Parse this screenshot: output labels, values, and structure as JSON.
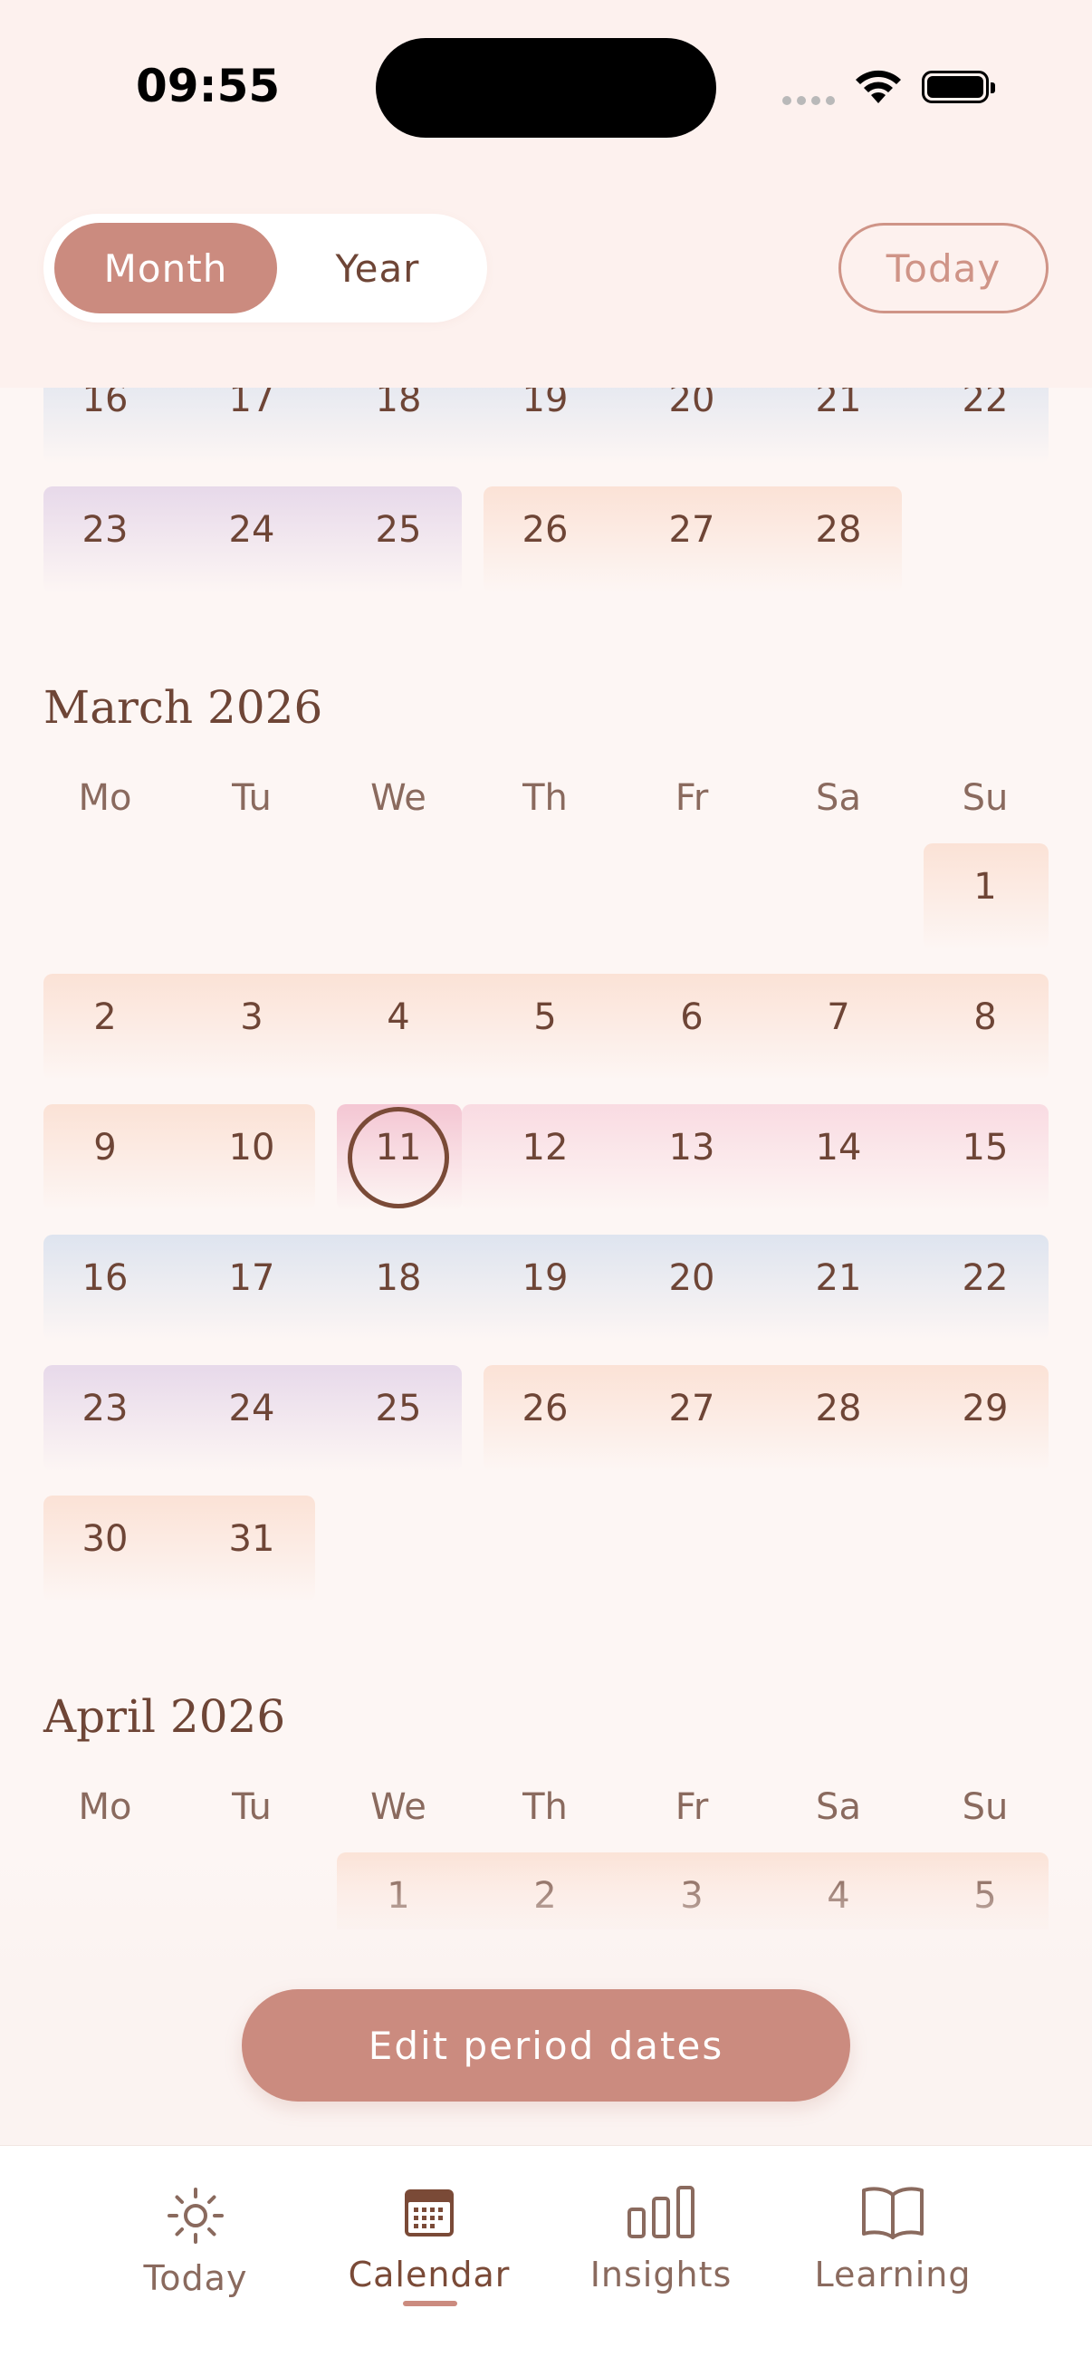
{
  "status": {
    "time": "09:55"
  },
  "header": {
    "view_month": "Month",
    "view_year": "Year",
    "today_button": "Today"
  },
  "weekdays": [
    "Mo",
    "Tu",
    "We",
    "Th",
    "Fr",
    "Sa",
    "Su"
  ],
  "calendar": {
    "feb_partial": {
      "rows": [
        [
          "16",
          "17",
          "18",
          "19",
          "20",
          "21",
          "22"
        ],
        [
          "23",
          "24",
          "25",
          "26",
          "27",
          "28",
          ""
        ]
      ]
    },
    "march": {
      "title": "March 2026",
      "rows": [
        [
          "",
          "",
          "",
          "",
          "",
          "",
          "1"
        ],
        [
          "2",
          "3",
          "4",
          "5",
          "6",
          "7",
          "8"
        ],
        [
          "9",
          "10",
          "11",
          "12",
          "13",
          "14",
          "15"
        ],
        [
          "16",
          "17",
          "18",
          "19",
          "20",
          "21",
          "22"
        ],
        [
          "23",
          "24",
          "25",
          "26",
          "27",
          "28",
          "29"
        ],
        [
          "30",
          "31",
          "",
          "",
          "",
          "",
          ""
        ]
      ],
      "today": "11"
    },
    "april": {
      "title": "April 2026",
      "rows": [
        [
          "",
          "",
          "1",
          "2",
          "3",
          "4",
          "5"
        ]
      ]
    }
  },
  "actions": {
    "edit_period": "Edit period dates"
  },
  "tabs": [
    {
      "label": "Today",
      "icon": "sun-icon"
    },
    {
      "label": "Calendar",
      "icon": "calendar-icon"
    },
    {
      "label": "Insights",
      "icon": "bar-chart-icon"
    },
    {
      "label": "Learning",
      "icon": "book-icon"
    }
  ],
  "colors": {
    "accent": "#cb8b7f",
    "text": "#6e4536",
    "period": "#fbe2d6",
    "fertile": "#e7d9ea",
    "luteal": "#dee4ef",
    "ovulation": "#f9dbe2"
  }
}
